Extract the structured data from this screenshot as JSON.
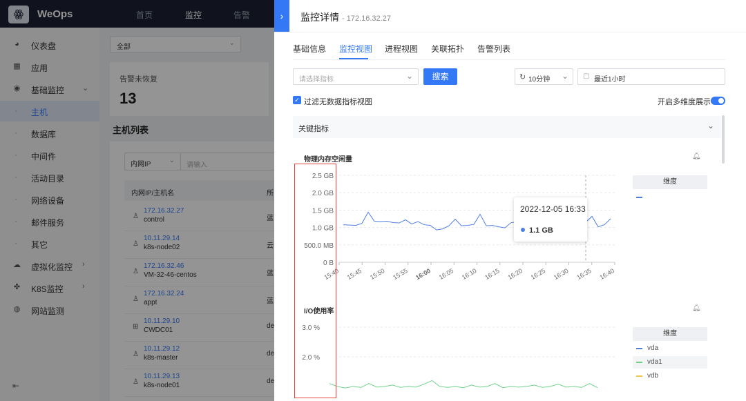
{
  "topbar": {
    "brand": "WeOps",
    "nav": [
      "首页",
      "监控",
      "告警"
    ]
  },
  "sidebar": {
    "items": [
      {
        "label": "仪表盘",
        "icon": "dashboard-icon",
        "glyph": "◕"
      },
      {
        "label": "应用",
        "icon": "apps-icon",
        "glyph": "▦"
      },
      {
        "label": "基础监控",
        "icon": "monitor-icon",
        "glyph": "◉",
        "arrow": "⌄"
      },
      {
        "label": "主机",
        "sub": true,
        "active": true
      },
      {
        "label": "数据库",
        "sub": true
      },
      {
        "label": "中间件",
        "sub": true
      },
      {
        "label": "活动目录",
        "sub": true
      },
      {
        "label": "网络设备",
        "sub": true
      },
      {
        "label": "邮件服务",
        "sub": true
      },
      {
        "label": "其它",
        "sub": true
      },
      {
        "label": "虚拟化监控",
        "icon": "virtualization-icon",
        "glyph": "☁",
        "arrow": "›"
      },
      {
        "label": "K8S监控",
        "icon": "k8s-icon",
        "glyph": "✤",
        "arrow": "›"
      },
      {
        "label": "网站监测",
        "icon": "web-icon",
        "glyph": "◍"
      }
    ],
    "collapse_glyph": "⇤"
  },
  "bg": {
    "filter_value": "全部",
    "alert_card": {
      "label": "告警未恢复",
      "value": "13"
    },
    "host_list_title": "主机列表",
    "search_field": "内网IP",
    "search_placeholder": "请输入",
    "col1": "内网IP/主机名",
    "col2": "所",
    "rows": [
      {
        "ip": "172.16.32.27",
        "name": "control",
        "os": "linux",
        "c": "蓝"
      },
      {
        "ip": "10.11.29.14",
        "name": "k8s-node02",
        "os": "linux",
        "c": "云"
      },
      {
        "ip": "172.16.32.46",
        "name": "VM-32-46-centos",
        "os": "linux",
        "c": "蓝"
      },
      {
        "ip": "172.16.32.24",
        "name": "appt",
        "os": "linux",
        "c": "蓝"
      },
      {
        "ip": "10.11.29.10",
        "name": "CWDC01",
        "os": "windows",
        "c": "de"
      },
      {
        "ip": "10.11.29.12",
        "name": "k8s-master",
        "os": "linux",
        "c": "de"
      },
      {
        "ip": "10.11.29.13",
        "name": "k8s-node01",
        "os": "linux",
        "c": "de"
      }
    ]
  },
  "drawer": {
    "title": "监控详情",
    "ip": "- 172.16.32.27",
    "tabs": [
      "基础信息",
      "监控视图",
      "进程视图",
      "关联拓扑",
      "告警列表"
    ],
    "metric_placeholder": "请选择指标",
    "search_button": "搜索",
    "interval": "10分钟",
    "range": "最近1小时",
    "filter_label": "过滤无数据指标视图",
    "multi_dim_label": "开启多维度展示",
    "section": "关键指标"
  },
  "chart_data": [
    {
      "type": "line",
      "title": "物理内存空闲量",
      "y_ticks": [
        "2.5 GB",
        "2.0 GB",
        "1.5 GB",
        "1.0 GB",
        "500.0 MB",
        "0 B"
      ],
      "ylim": [
        0,
        2.5
      ],
      "x_ticks": [
        "15:40",
        "15:45",
        "15:50",
        "15:55",
        "16:00",
        "16:05",
        "16:10",
        "16:15",
        "16:20",
        "16:25",
        "16:30",
        "16:35",
        "16:40"
      ],
      "legend_title": "维度",
      "series": [
        {
          "color": "#4e7fe0",
          "values": [
            1.08,
            1.07,
            1.06,
            1.12,
            1.44,
            1.18,
            1.17,
            1.18,
            1.14,
            1.13,
            1.22,
            1.1,
            1.17,
            1.08,
            1.06,
            0.93,
            0.96,
            1.05,
            1.24,
            1.05,
            1.06,
            1.09,
            1.38,
            1.05,
            1.06,
            1.02,
            0.99,
            1.14,
            1.16,
            1.08,
            1.18,
            1.06,
            1.12,
            1.04,
            1.32,
            1.01,
            1.06,
            1.24,
            1.1,
            1.15,
            1.32,
            1.02,
            1.08,
            1.25
          ]
        }
      ],
      "tooltip": {
        "time": "2022-12-05 16:33",
        "value": "1.1 GB"
      }
    },
    {
      "type": "line",
      "title": "I/O使用率",
      "y_ticks": [
        "3.0 %",
        "2.0 %"
      ],
      "legend_title": "维度",
      "series": [
        {
          "name": "vda",
          "color": "#4e7fe0",
          "values": []
        },
        {
          "name": "vda1",
          "color": "#6fd08c",
          "values": [
            1.1,
            1.0,
            0.95,
            1.0,
            0.97,
            1.1,
            0.98,
            1.0,
            1.05,
            0.97,
            1.0,
            0.98,
            1.08,
            1.2,
            1.0,
            0.97,
            1.0,
            0.96,
            1.05,
            0.98,
            1.0,
            1.1,
            0.96,
            1.0,
            0.98,
            1.0,
            1.05,
            0.97,
            1.0,
            1.08,
            0.98,
            1.0,
            0.97,
            1.1,
            0.96
          ]
        },
        {
          "name": "vdb",
          "color": "#f5c542",
          "values": []
        }
      ]
    }
  ]
}
